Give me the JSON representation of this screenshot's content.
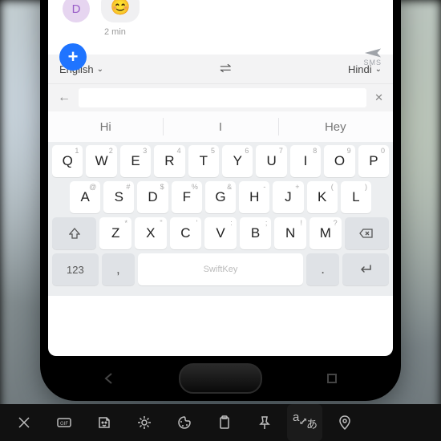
{
  "chat": {
    "avatar_letter": "D",
    "emoji": "😊",
    "timestamp": "2 min",
    "send_label": "SMS"
  },
  "translator": {
    "lang_left": "English",
    "lang_right": "Hindi"
  },
  "suggestions": [
    "Hi",
    "I",
    "Hey"
  ],
  "keyboard": {
    "row1": [
      {
        "k": "Q",
        "a": "1"
      },
      {
        "k": "W",
        "a": "2"
      },
      {
        "k": "E",
        "a": "3"
      },
      {
        "k": "R",
        "a": "4"
      },
      {
        "k": "T",
        "a": "5"
      },
      {
        "k": "Y",
        "a": "6"
      },
      {
        "k": "U",
        "a": "7"
      },
      {
        "k": "I",
        "a": "8"
      },
      {
        "k": "O",
        "a": "9"
      },
      {
        "k": "P",
        "a": "0"
      }
    ],
    "row2": [
      {
        "k": "A",
        "a": "@"
      },
      {
        "k": "S",
        "a": "#"
      },
      {
        "k": "D",
        "a": "$"
      },
      {
        "k": "F",
        "a": "%"
      },
      {
        "k": "G",
        "a": "&"
      },
      {
        "k": "H",
        "a": "-"
      },
      {
        "k": "J",
        "a": "+"
      },
      {
        "k": "K",
        "a": "("
      },
      {
        "k": "L",
        "a": ")"
      }
    ],
    "row3": [
      {
        "k": "Z",
        "a": "*"
      },
      {
        "k": "X",
        "a": "\""
      },
      {
        "k": "C",
        "a": "'"
      },
      {
        "k": "V",
        "a": ":"
      },
      {
        "k": "B",
        "a": ";"
      },
      {
        "k": "N",
        "a": "!"
      },
      {
        "k": "M",
        "a": "?"
      }
    ],
    "numkey": "123",
    "space_label": "SwiftKey",
    "comma": ",",
    "period": "."
  },
  "toolbar_icons": [
    "close",
    "gif",
    "sticker",
    "settings",
    "theme",
    "clipboard",
    "pin",
    "translate",
    "location"
  ]
}
